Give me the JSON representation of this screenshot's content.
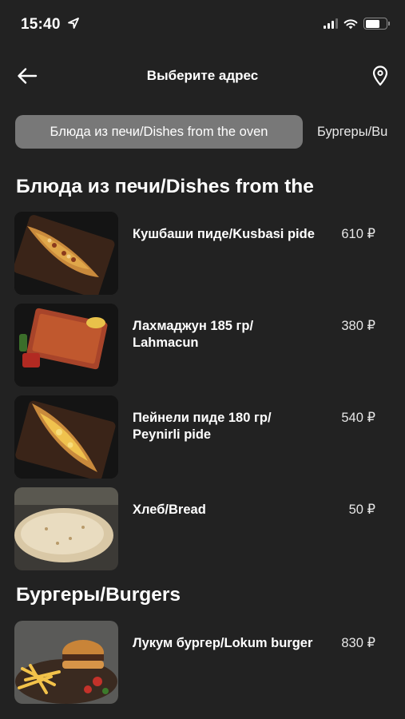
{
  "status_bar": {
    "time": "15:40"
  },
  "header": {
    "title": "Выберите адрес",
    "back_icon": "arrow-left-icon",
    "location_icon": "map-pin-icon"
  },
  "tabs": [
    {
      "label": "Блюда из печи/Dishes from the oven",
      "active": true
    },
    {
      "label": "Бургеры/Bu",
      "active": false
    }
  ],
  "sections": [
    {
      "title": "Блюда из печи/Dishes from the",
      "items": [
        {
          "name": "Кушбаши пиде/Kusbasi pide",
          "price": "610 ₽"
        },
        {
          "name": "Лахмаджун 185 гр/ Lahmacun",
          "price": "380 ₽"
        },
        {
          "name": "Пейнели пиде 180 гр/ Peynirli pide",
          "price": "540 ₽"
        },
        {
          "name": "Хлеб/Bread",
          "price": "50 ₽"
        }
      ]
    },
    {
      "title": "Бургеры/Burgers",
      "items": [
        {
          "name": "Лукум бургер/Lokum burger",
          "price": "830 ₽"
        }
      ]
    }
  ],
  "colors": {
    "background": "#222222",
    "active_tab": "#787878",
    "text": "#ffffff"
  }
}
